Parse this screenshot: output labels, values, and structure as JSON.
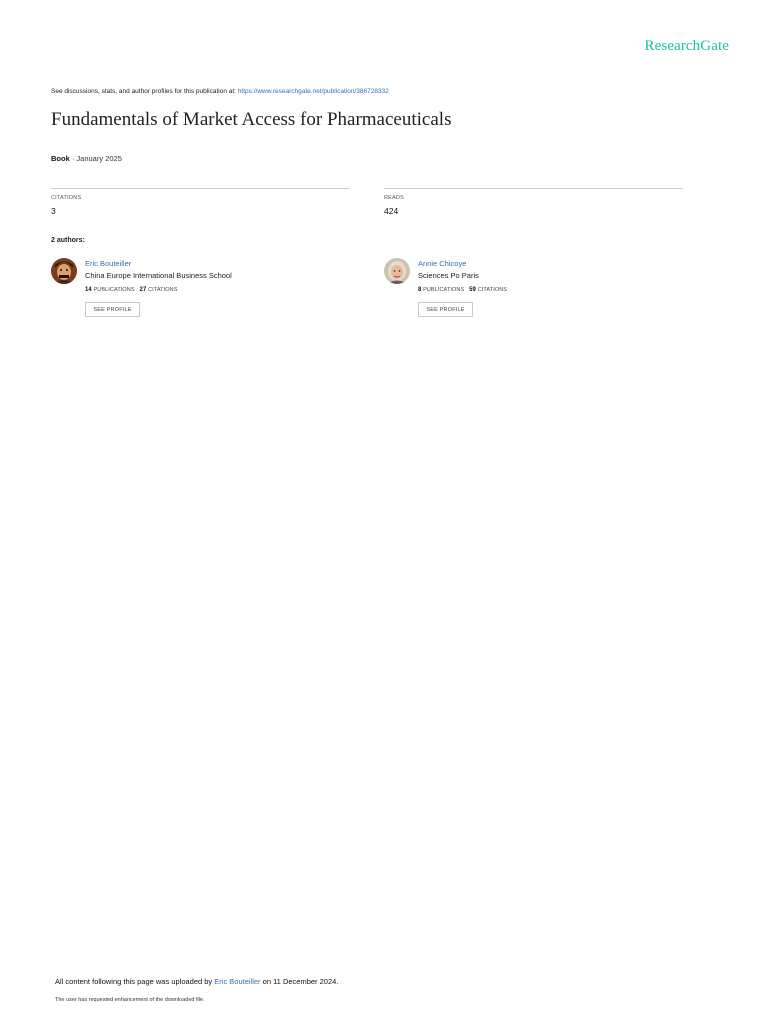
{
  "brand": {
    "logo_text": "ResearchGate",
    "accent": "#19c1a9",
    "link_color": "#2f70b8"
  },
  "header": {
    "discuss_text": "See discussions, stats, and author profiles for this publication at: ",
    "publication_url": "https://www.researchgate.net/publication/386728332"
  },
  "publication": {
    "title": "Fundamentals of Market Access for Pharmaceuticals",
    "type": "Book",
    "date": " · January 2025"
  },
  "stats": {
    "citations_label": "CITATIONS",
    "citations_value": "3",
    "reads_label": "READS",
    "reads_value": "424"
  },
  "authors_heading": "2 authors:",
  "authors": [
    {
      "name": "Eric Bouteiller",
      "institution": "China Europe International Business School",
      "publications": "14",
      "publications_label": "PUBLICATIONS",
      "citations": "27",
      "citations_label": "CITATIONS",
      "button_label": "SEE PROFILE",
      "avatar_icon": "man-portrait-icon"
    },
    {
      "name": "Annie Chicoye",
      "institution": "Sciences Po Paris",
      "publications": "8",
      "publications_label": "PUBLICATIONS",
      "citations": "59",
      "citations_label": "CITATIONS",
      "button_label": "SEE PROFILE",
      "avatar_icon": "woman-portrait-icon"
    }
  ],
  "footer": {
    "upload_prefix": "All content following this page was uploaded by ",
    "uploader": "Eric Bouteiller",
    "upload_suffix": " on 11 December 2024.",
    "enhancement_note": "The user has requested enhancement of the downloaded file."
  }
}
